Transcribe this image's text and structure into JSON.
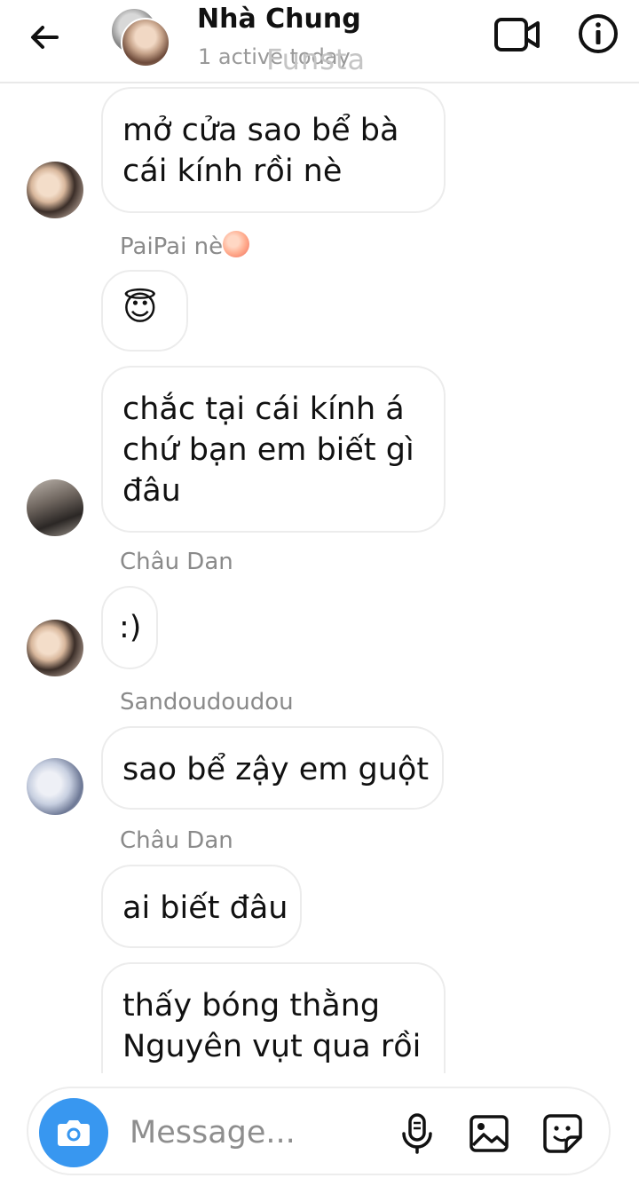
{
  "header": {
    "title": "Nhà Chung",
    "subtitle": "1 active today",
    "watermark": "Funsta"
  },
  "messages": [
    {
      "text": "mở cửa sao bể bà\ncái kính rồi nè",
      "avatar": "a"
    },
    {
      "sender": "PaiPai nè",
      "sender_emoji": "peach-emoji",
      "text": "😇"
    },
    {
      "text": "chắc tại cái kính á\nchứ bạn em biết gì\nđâu",
      "avatar": "b"
    },
    {
      "sender": "Châu Dan",
      "text": ":)",
      "avatar": "a"
    },
    {
      "sender": "Sandoudoudou",
      "text": "sao bể zậy em guột",
      "avatar": "c"
    },
    {
      "sender": "Châu Dan",
      "text": "ai biết đâu"
    },
    {
      "text": "thấy bóng thằng\nNguyên vụt qua rồi"
    }
  ],
  "composer": {
    "placeholder": "Message..."
  },
  "icons": {
    "back": "arrow-left-icon",
    "video": "video-camera-icon",
    "info": "info-icon",
    "camera": "camera-icon",
    "mic": "microphone-icon",
    "gallery": "image-icon",
    "sticker": "sticker-icon"
  },
  "colors": {
    "accent": "#3897f0",
    "bubble_border": "#ececec",
    "sender_text": "#8a8a8a"
  }
}
